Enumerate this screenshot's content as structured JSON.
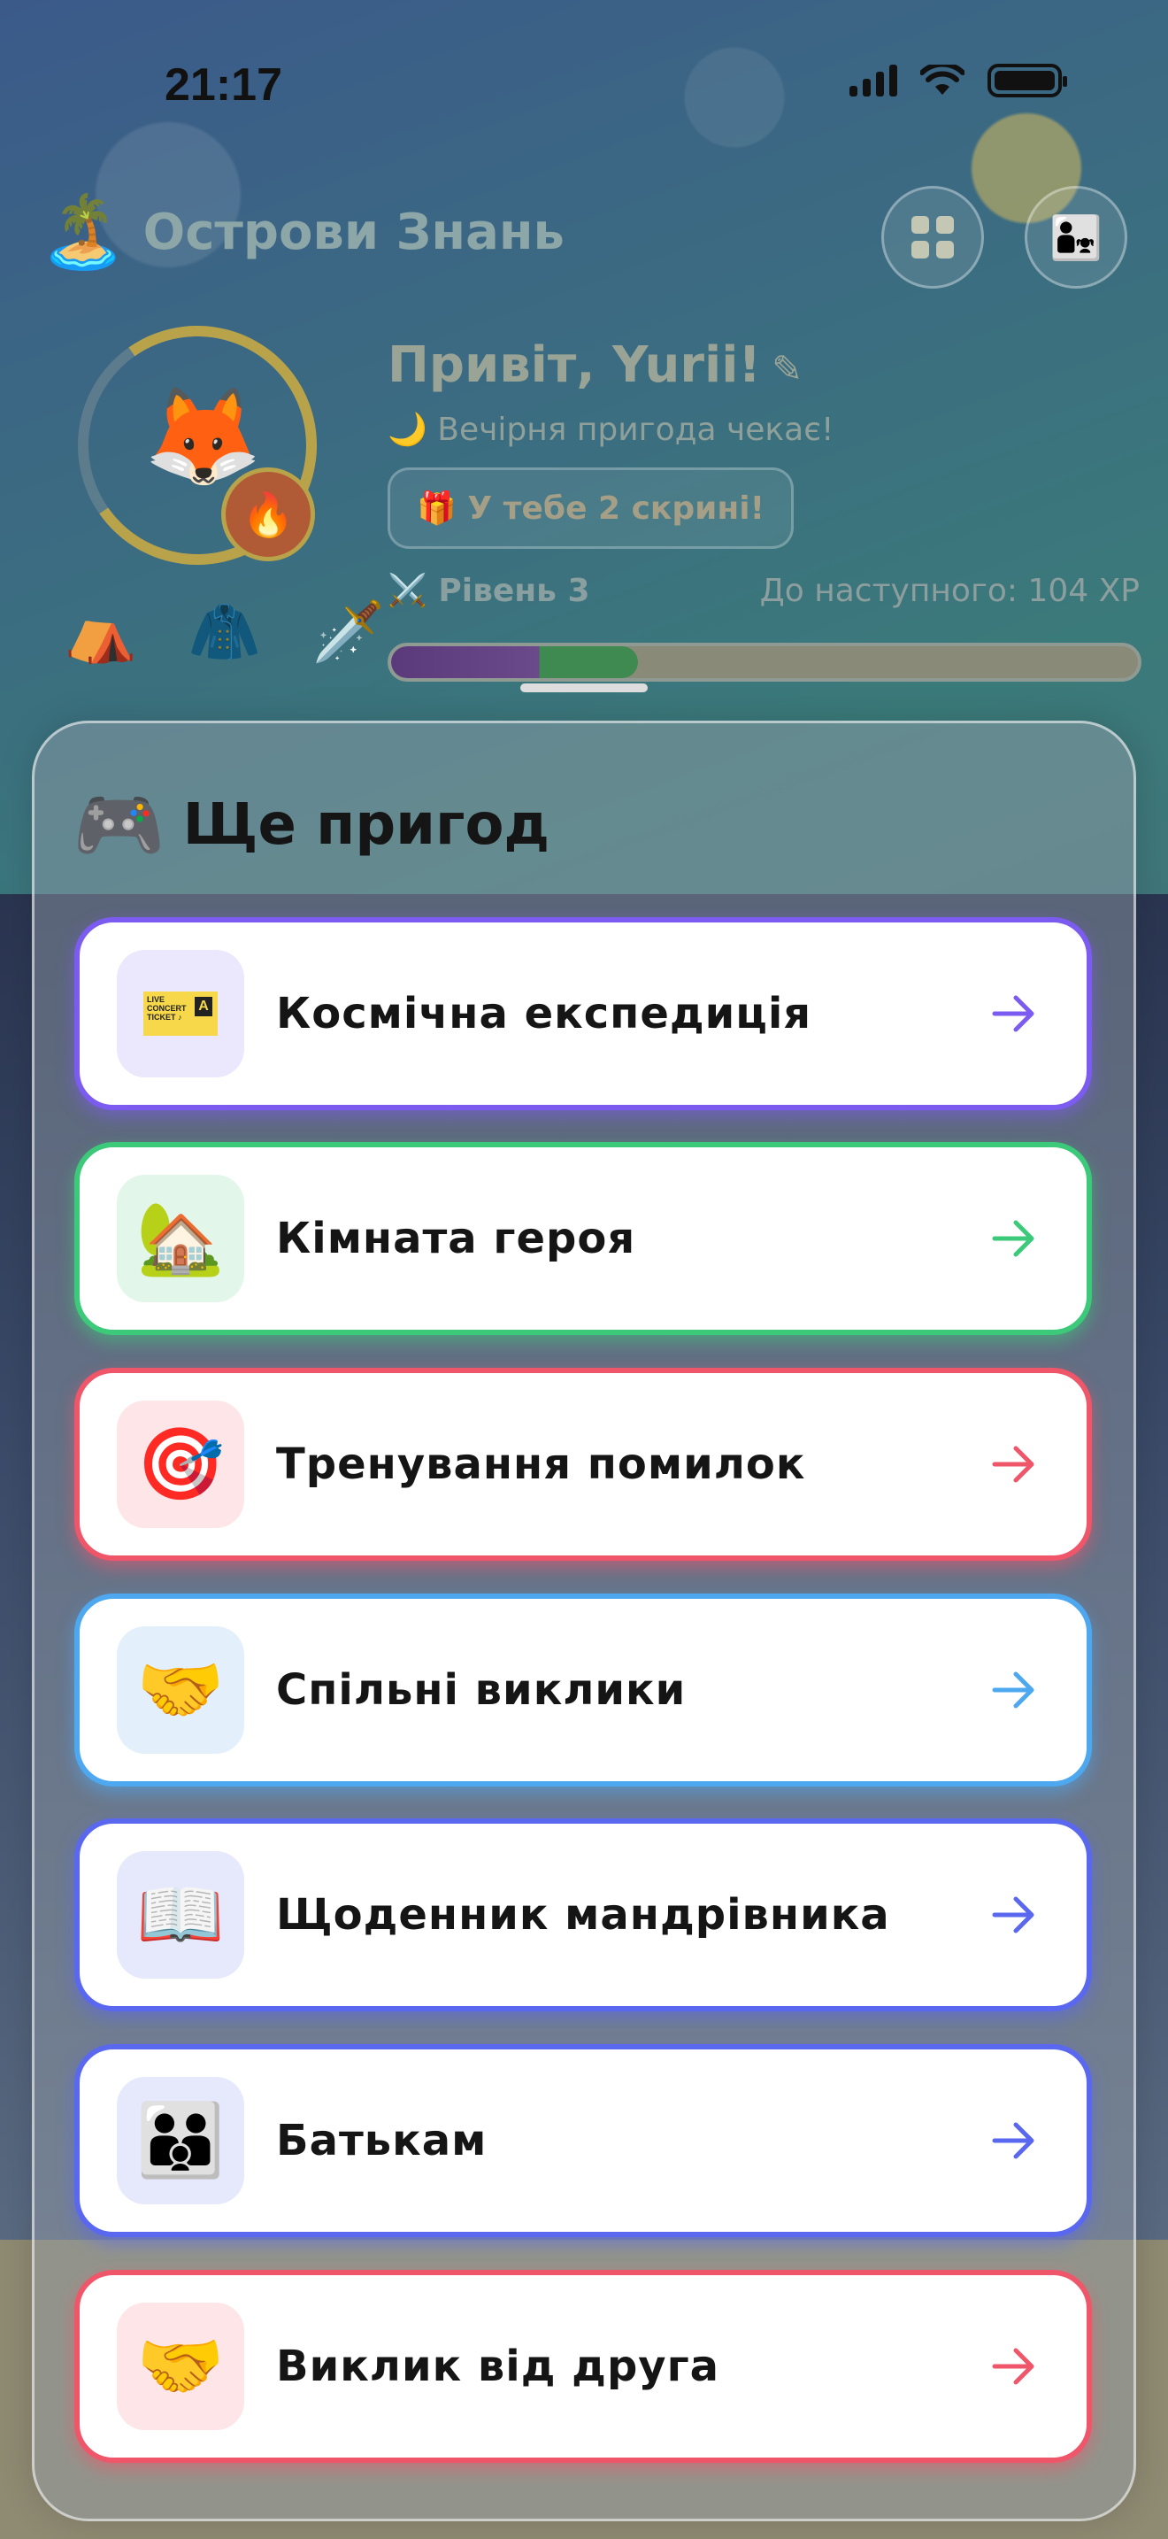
{
  "status_bar": {
    "time": "21:17"
  },
  "header": {
    "logo_icon": "palm-island-icon",
    "title": "Острови Знань",
    "grid_icon": "grid-icon",
    "family_icon": "family-icon"
  },
  "profile": {
    "avatar_icon": "fox-icon",
    "streak_icon": "fire-icon",
    "greeting": "Привіт, Yurii!",
    "subtitle": "🌙 Вечірня пригода чекає!",
    "chests": "🎁 У тебе 2 скрині!",
    "level": "⚔️ Рівень 3",
    "next_level": "До наступного: 104 XP",
    "xp_progress": 0.33
  },
  "sheet": {
    "title_icon": "game-controller-icon",
    "title": "Ще пригод",
    "items": [
      {
        "label": "Космічна експедиція",
        "icon": "ticket-icon",
        "border": "#7c5cf0",
        "tile_bg": "#ebe7fc",
        "arrow": "#7c5cf0"
      },
      {
        "label": "Кімната героя",
        "icon": "house-icon",
        "border": "#3dc97a",
        "tile_bg": "#e3f6ea",
        "arrow": "#3dc97a"
      },
      {
        "label": "Тренування помилок",
        "icon": "target-icon",
        "border": "#f0566a",
        "tile_bg": "#fde5e8",
        "arrow": "#f0566a"
      },
      {
        "label": "Спільні виклики",
        "icon": "handshake-icon",
        "border": "#4ea8f0",
        "tile_bg": "#e3f0fc",
        "arrow": "#4ea8f0"
      },
      {
        "label": "Щоденник мандрівника",
        "icon": "book-icon",
        "border": "#5a68f0",
        "tile_bg": "#e6e8fc",
        "arrow": "#5a68f0"
      },
      {
        "label": "Батькам",
        "icon": "parents-icon",
        "border": "#5a68f0",
        "tile_bg": "#e6e8fc",
        "arrow": "#5a68f0"
      },
      {
        "label": "Виклик від друга",
        "icon": "handshake-icon",
        "border": "#f0566a",
        "tile_bg": "#fde5e8",
        "arrow": "#f0566a"
      }
    ]
  }
}
